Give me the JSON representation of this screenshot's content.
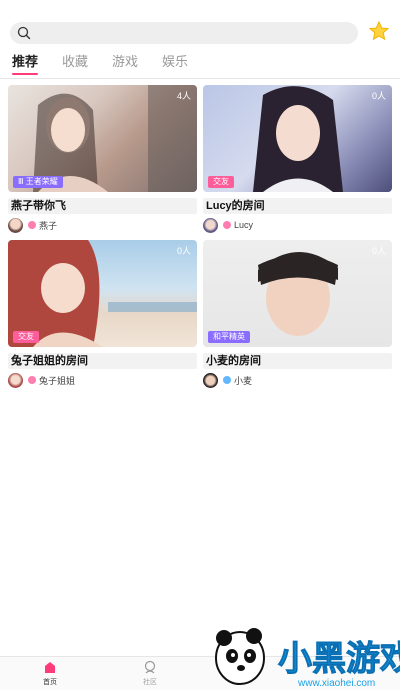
{
  "search": {
    "placeholder": ""
  },
  "tabs": [
    {
      "label": "推荐",
      "active": true
    },
    {
      "label": "收藏"
    },
    {
      "label": "游戏"
    },
    {
      "label": "娱乐"
    }
  ],
  "cards": [
    {
      "title": "燕子带你飞",
      "count": "4人",
      "tag": "Ⅲ 王者荣耀",
      "tag_color": "#8a6cff",
      "host": "燕子",
      "gender_color": "#ff7eb0"
    },
    {
      "title": "Lucy的房间",
      "count": "0人",
      "tag": "交友",
      "tag_color": "#ff5c9a",
      "host": "Lucy",
      "gender_color": "#ff7eb0"
    },
    {
      "title": "兔子姐姐的房间",
      "count": "0人",
      "tag": "交友",
      "tag_color": "#ff5c9a",
      "host": "兔子姐姐",
      "gender_color": "#ff7eb0"
    },
    {
      "title": "小麦的房间",
      "count": "0人",
      "tag": "和平精英",
      "tag_color": "#8a6cff",
      "host": "小麦",
      "gender_color": "#62b7ff"
    }
  ],
  "bottom_nav": [
    {
      "label": "首页",
      "icon": "home-icon",
      "active": true
    },
    {
      "label": "社区",
      "icon": "community-icon"
    }
  ],
  "watermark": {
    "text": "小黑游戏",
    "url": "www.xiaohei.com"
  },
  "colors": {
    "accent": "#ff3b7a",
    "star": "#ffd23f"
  }
}
